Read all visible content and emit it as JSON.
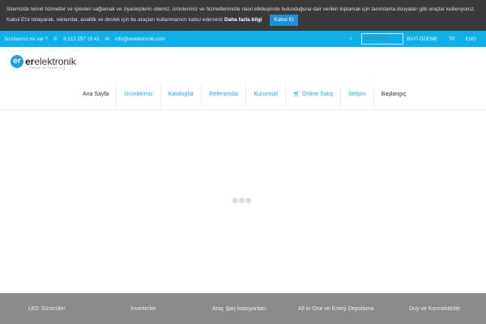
{
  "cookie": {
    "text": "Sitemizde temel hizmetler ve işlevleri sağlamak ve ziyaretçilerin sitemiz, ürünlerimiz ve hizmetlerimizle nasıl etkileşimde bulunduğuna dair verileri toplamak için tanımlama dosyaları gibi araçlar kullanıyoruz. Kabul Et'e tıklayarak, reklamlar, analitik ve destek için bu araçları kullanmamızı kabul edersiniz",
    "more": "Daha fazla bilgi",
    "accept": "Kabul Et"
  },
  "topbar": {
    "question": "Sorularınız mı var ?",
    "phone": "0 212 297 19 41",
    "email": "info@erelektronik.com",
    "search_placeholder": "Arama terimi...",
    "dealer": "BAYİ ÖDEME",
    "lang_tr": "TR",
    "lang_en": "ENG"
  },
  "logo": {
    "mark": "er",
    "bold": "er",
    "rest": "elektronik",
    "sub": "Sanayi ve Ticaret A.Ş."
  },
  "nav": [
    "Ana Sayfa",
    "Ürünlerimiz",
    "Kataloglar",
    "Referanslar",
    "Kurumsal",
    "Online Satış",
    "İletişim",
    "Başlangıç"
  ],
  "footer": [
    "LED Sürücüler",
    "İnverterler",
    "Araç Şarj İstasyonları",
    "All in One ve Enerji Depolama",
    "Duy ve Konnektörler"
  ]
}
